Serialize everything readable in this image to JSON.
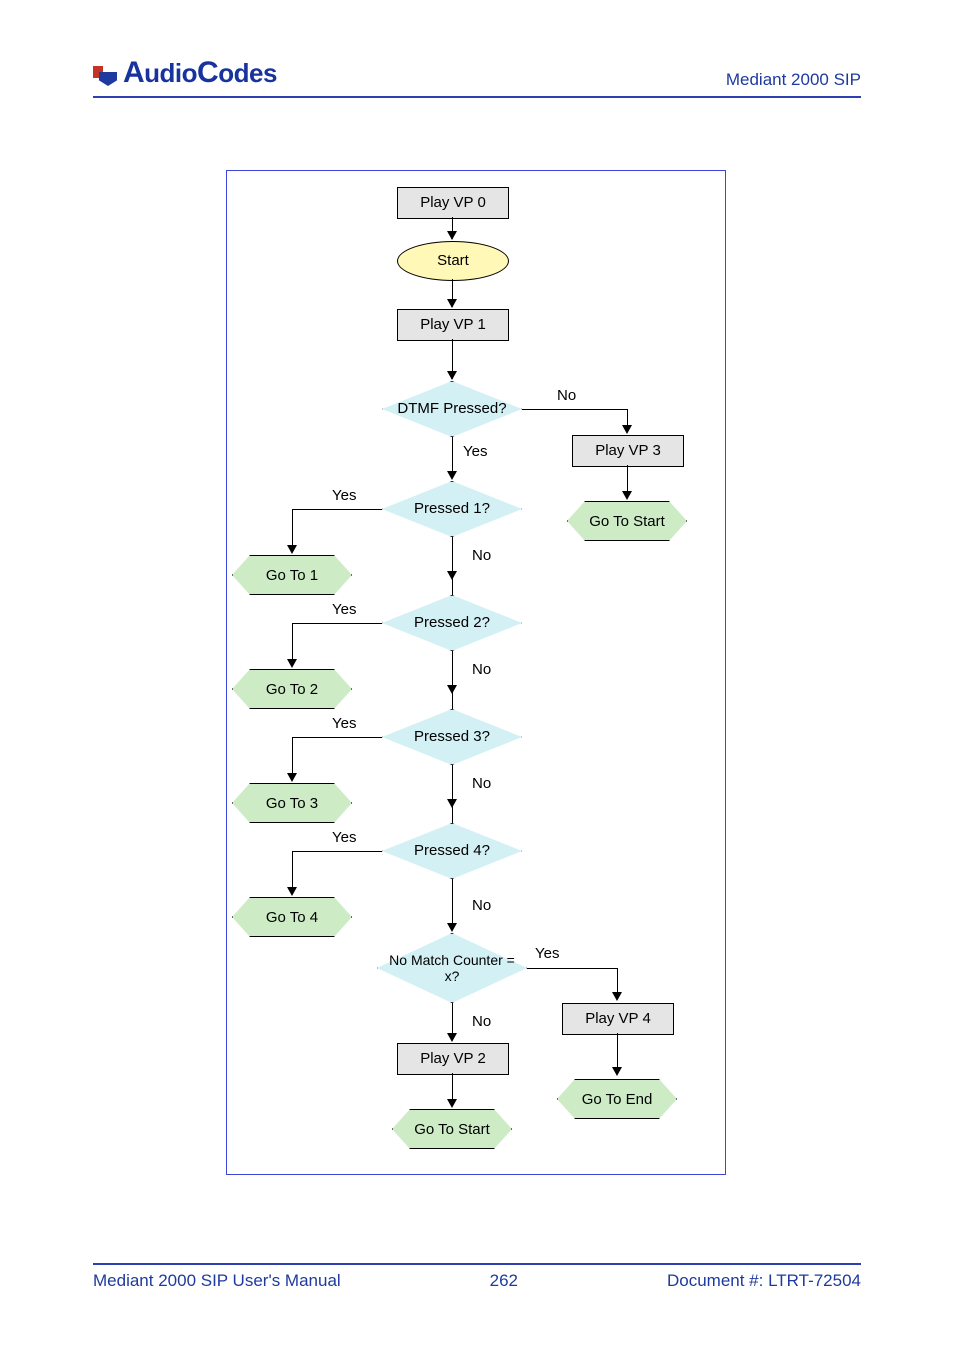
{
  "header": {
    "logo_text": "AudioCodes",
    "product": "Mediant 2000 SIP"
  },
  "footer": {
    "left": "Mediant 2000 SIP User's Manual",
    "center": "262",
    "right": "Document #: LTRT-72504"
  },
  "labels": {
    "yes": "Yes",
    "no": "No"
  },
  "shapes": {
    "play_vp0": "Play VP 0",
    "start": "Start",
    "play_vp1": "Play VP 1",
    "dtmf": "DTMF Pressed?",
    "play_vp3": "Play VP 3",
    "goto_start_r": "Go To Start",
    "pressed1": "Pressed 1?",
    "goto1": "Go To 1",
    "pressed2": "Pressed 2?",
    "goto2": "Go To 2",
    "pressed3": "Pressed 3?",
    "goto3": "Go To 3",
    "pressed4": "Pressed 4?",
    "goto4": "Go To 4",
    "nomatch": "No Match Counter = x?",
    "play_vp4": "Play VP 4",
    "goto_end": "Go To End",
    "play_vp2": "Play VP 2",
    "goto_start_b": "Go To Start"
  }
}
